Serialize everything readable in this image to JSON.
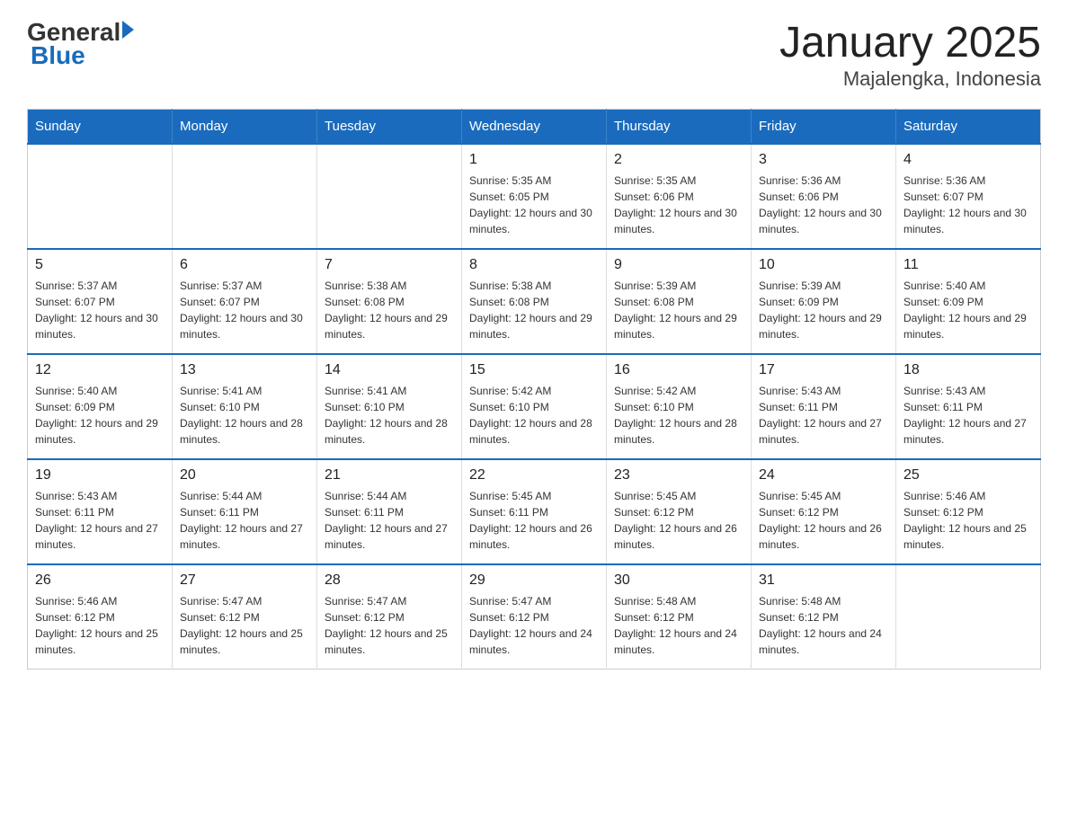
{
  "header": {
    "logo": {
      "text_general": "General",
      "text_blue": "Blue",
      "alt": "GeneralBlue logo"
    },
    "title": "January 2025",
    "subtitle": "Majalengka, Indonesia"
  },
  "calendar": {
    "days_of_week": [
      "Sunday",
      "Monday",
      "Tuesday",
      "Wednesday",
      "Thursday",
      "Friday",
      "Saturday"
    ],
    "weeks": [
      [
        {
          "day": "",
          "info": ""
        },
        {
          "day": "",
          "info": ""
        },
        {
          "day": "",
          "info": ""
        },
        {
          "day": "1",
          "info": "Sunrise: 5:35 AM\nSunset: 6:05 PM\nDaylight: 12 hours and 30 minutes."
        },
        {
          "day": "2",
          "info": "Sunrise: 5:35 AM\nSunset: 6:06 PM\nDaylight: 12 hours and 30 minutes."
        },
        {
          "day": "3",
          "info": "Sunrise: 5:36 AM\nSunset: 6:06 PM\nDaylight: 12 hours and 30 minutes."
        },
        {
          "day": "4",
          "info": "Sunrise: 5:36 AM\nSunset: 6:07 PM\nDaylight: 12 hours and 30 minutes."
        }
      ],
      [
        {
          "day": "5",
          "info": "Sunrise: 5:37 AM\nSunset: 6:07 PM\nDaylight: 12 hours and 30 minutes."
        },
        {
          "day": "6",
          "info": "Sunrise: 5:37 AM\nSunset: 6:07 PM\nDaylight: 12 hours and 30 minutes."
        },
        {
          "day": "7",
          "info": "Sunrise: 5:38 AM\nSunset: 6:08 PM\nDaylight: 12 hours and 29 minutes."
        },
        {
          "day": "8",
          "info": "Sunrise: 5:38 AM\nSunset: 6:08 PM\nDaylight: 12 hours and 29 minutes."
        },
        {
          "day": "9",
          "info": "Sunrise: 5:39 AM\nSunset: 6:08 PM\nDaylight: 12 hours and 29 minutes."
        },
        {
          "day": "10",
          "info": "Sunrise: 5:39 AM\nSunset: 6:09 PM\nDaylight: 12 hours and 29 minutes."
        },
        {
          "day": "11",
          "info": "Sunrise: 5:40 AM\nSunset: 6:09 PM\nDaylight: 12 hours and 29 minutes."
        }
      ],
      [
        {
          "day": "12",
          "info": "Sunrise: 5:40 AM\nSunset: 6:09 PM\nDaylight: 12 hours and 29 minutes."
        },
        {
          "day": "13",
          "info": "Sunrise: 5:41 AM\nSunset: 6:10 PM\nDaylight: 12 hours and 28 minutes."
        },
        {
          "day": "14",
          "info": "Sunrise: 5:41 AM\nSunset: 6:10 PM\nDaylight: 12 hours and 28 minutes."
        },
        {
          "day": "15",
          "info": "Sunrise: 5:42 AM\nSunset: 6:10 PM\nDaylight: 12 hours and 28 minutes."
        },
        {
          "day": "16",
          "info": "Sunrise: 5:42 AM\nSunset: 6:10 PM\nDaylight: 12 hours and 28 minutes."
        },
        {
          "day": "17",
          "info": "Sunrise: 5:43 AM\nSunset: 6:11 PM\nDaylight: 12 hours and 27 minutes."
        },
        {
          "day": "18",
          "info": "Sunrise: 5:43 AM\nSunset: 6:11 PM\nDaylight: 12 hours and 27 minutes."
        }
      ],
      [
        {
          "day": "19",
          "info": "Sunrise: 5:43 AM\nSunset: 6:11 PM\nDaylight: 12 hours and 27 minutes."
        },
        {
          "day": "20",
          "info": "Sunrise: 5:44 AM\nSunset: 6:11 PM\nDaylight: 12 hours and 27 minutes."
        },
        {
          "day": "21",
          "info": "Sunrise: 5:44 AM\nSunset: 6:11 PM\nDaylight: 12 hours and 27 minutes."
        },
        {
          "day": "22",
          "info": "Sunrise: 5:45 AM\nSunset: 6:11 PM\nDaylight: 12 hours and 26 minutes."
        },
        {
          "day": "23",
          "info": "Sunrise: 5:45 AM\nSunset: 6:12 PM\nDaylight: 12 hours and 26 minutes."
        },
        {
          "day": "24",
          "info": "Sunrise: 5:45 AM\nSunset: 6:12 PM\nDaylight: 12 hours and 26 minutes."
        },
        {
          "day": "25",
          "info": "Sunrise: 5:46 AM\nSunset: 6:12 PM\nDaylight: 12 hours and 25 minutes."
        }
      ],
      [
        {
          "day": "26",
          "info": "Sunrise: 5:46 AM\nSunset: 6:12 PM\nDaylight: 12 hours and 25 minutes."
        },
        {
          "day": "27",
          "info": "Sunrise: 5:47 AM\nSunset: 6:12 PM\nDaylight: 12 hours and 25 minutes."
        },
        {
          "day": "28",
          "info": "Sunrise: 5:47 AM\nSunset: 6:12 PM\nDaylight: 12 hours and 25 minutes."
        },
        {
          "day": "29",
          "info": "Sunrise: 5:47 AM\nSunset: 6:12 PM\nDaylight: 12 hours and 24 minutes."
        },
        {
          "day": "30",
          "info": "Sunrise: 5:48 AM\nSunset: 6:12 PM\nDaylight: 12 hours and 24 minutes."
        },
        {
          "day": "31",
          "info": "Sunrise: 5:48 AM\nSunset: 6:12 PM\nDaylight: 12 hours and 24 minutes."
        },
        {
          "day": "",
          "info": ""
        }
      ]
    ]
  }
}
